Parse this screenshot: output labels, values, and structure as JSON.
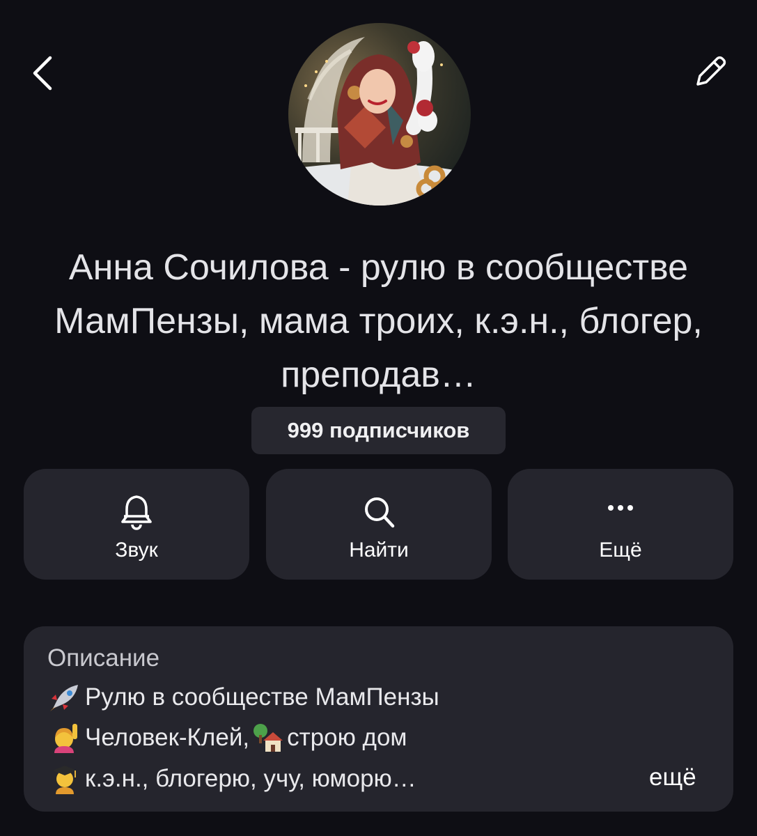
{
  "header": {
    "back_icon": "chevron-left-icon",
    "edit_icon": "pencil-icon"
  },
  "channel": {
    "title": "Анна Сочилова - рулю в сообществе МамПензы, мама троих, к.э.н., блогер, преподав…",
    "subscribers": "999 подписчиков"
  },
  "actions": [
    {
      "label": "Звук",
      "icon": "bell-icon"
    },
    {
      "label": "Найти",
      "icon": "search-icon"
    },
    {
      "label": "Ещё",
      "icon": "more-dots-icon"
    }
  ],
  "description": {
    "heading": "Описание",
    "lines": [
      {
        "emoji": "rocket-emoji",
        "text": "Рулю в сообществе МамПензы"
      },
      {
        "emoji": "raising-hand-emoji",
        "text": "Человек-Клей, ",
        "emoji2": "house-with-garden-emoji",
        "text2": " строю дом"
      },
      {
        "emoji": "student-emoji",
        "text": " к.э.н., блогерю, учу, юморю…"
      }
    ],
    "more_label": "ещё"
  }
}
